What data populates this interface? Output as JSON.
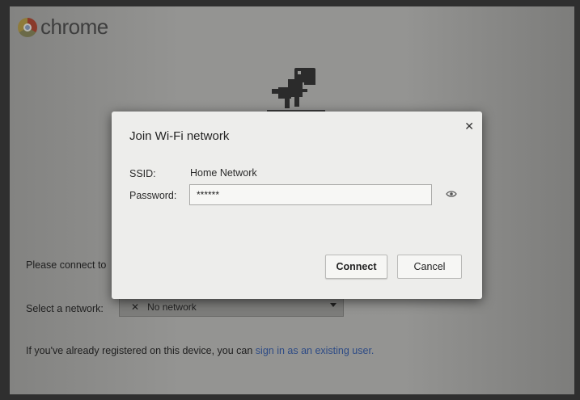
{
  "brand": {
    "name": "chrome"
  },
  "background": {
    "connect_prompt": "Please connect to",
    "select_network_label": "Select a network:",
    "network_select_value": "No network",
    "existing_user_text": "If you've already registered on this device, you can ",
    "existing_user_link": "sign in as an existing user."
  },
  "dialog": {
    "title": "Join Wi-Fi network",
    "ssid_label": "SSID:",
    "ssid_value": "Home Network",
    "password_label": "Password:",
    "password_value": "******",
    "connect_label": "Connect",
    "cancel_label": "Cancel"
  },
  "icons": {
    "close": "close-icon",
    "show_password": "eye-icon",
    "logo": "chrome-logo-icon",
    "dropdown": "chevron-down-icon",
    "network": "no-network-icon"
  },
  "colors": {
    "screen_bg": "#8e8e8c",
    "dialog_bg": "#ededeb",
    "link": "#2d4b86"
  }
}
